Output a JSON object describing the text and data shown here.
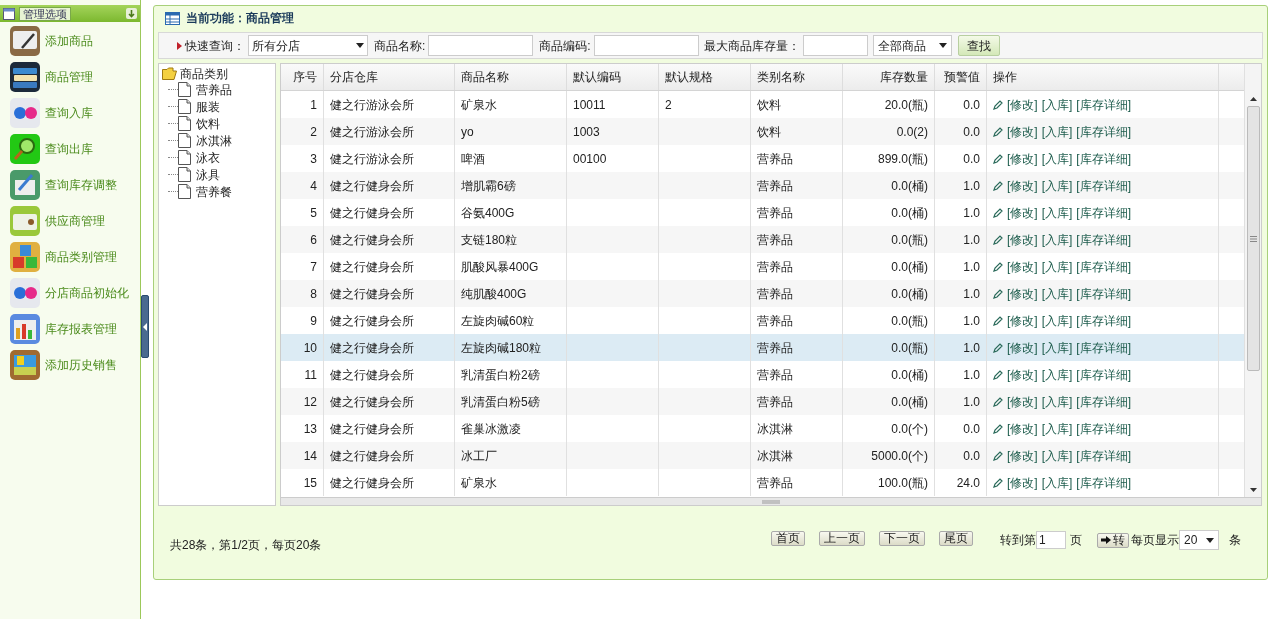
{
  "sidebar": {
    "header": "管理选项",
    "items": [
      {
        "label": "添加商品"
      },
      {
        "label": "商品管理"
      },
      {
        "label": "查询入库"
      },
      {
        "label": "查询出库"
      },
      {
        "label": "查询库存调整"
      },
      {
        "label": "供应商管理"
      },
      {
        "label": "商品类别管理"
      },
      {
        "label": "分店商品初始化"
      },
      {
        "label": "库存报表管理"
      },
      {
        "label": "添加历史销售"
      }
    ]
  },
  "panel": {
    "title": "当前功能：商品管理"
  },
  "search": {
    "quick_label": "快速查询：",
    "store_select": "所有分店",
    "name_label": "商品名称:",
    "code_label": "商品编码:",
    "max_stock_label": "最大商品库存量：",
    "type_select": "全部商品",
    "button": "查找"
  },
  "tree": {
    "label": "商品类别",
    "expanded": true,
    "children": [
      {
        "label": "营养品"
      },
      {
        "label": "服装"
      },
      {
        "label": "饮料"
      },
      {
        "label": "冰淇淋"
      },
      {
        "label": "泳衣"
      },
      {
        "label": "泳具"
      },
      {
        "label": "营养餐"
      }
    ]
  },
  "table": {
    "columns": [
      "序号",
      "分店仓库",
      "商品名称",
      "默认编码",
      "默认规格",
      "类别名称",
      "库存数量",
      "预警值",
      "操作"
    ],
    "rows": [
      {
        "cells": [
          "1",
          "健之行游泳会所",
          "矿泉水",
          "10011",
          "2",
          "饮料",
          "20.0(瓶)",
          "0.0"
        ],
        "actions": [
          "[修改]",
          "[入库]",
          "[库存详细]"
        ],
        "selected": false
      },
      {
        "cells": [
          "2",
          "健之行游泳会所",
          "yo",
          "1003",
          "",
          "饮料",
          "0.0(2)",
          "0.0"
        ],
        "actions": [
          "[修改]",
          "[入库]",
          "[库存详细]"
        ],
        "selected": false
      },
      {
        "cells": [
          "3",
          "健之行游泳会所",
          "啤酒",
          "00100",
          "",
          "营养品",
          "899.0(瓶)",
          "0.0"
        ],
        "actions": [
          "[修改]",
          "[入库]",
          "[库存详细]"
        ],
        "selected": false
      },
      {
        "cells": [
          "4",
          "健之行健身会所",
          "增肌霸6磅",
          "",
          "",
          "营养品",
          "0.0(桶)",
          "1.0"
        ],
        "actions": [
          "[修改]",
          "[入库]",
          "[库存详细]"
        ],
        "selected": false
      },
      {
        "cells": [
          "5",
          "健之行健身会所",
          "谷氨400G",
          "",
          "",
          "营养品",
          "0.0(桶)",
          "1.0"
        ],
        "actions": [
          "[修改]",
          "[入库]",
          "[库存详细]"
        ],
        "selected": false
      },
      {
        "cells": [
          "6",
          "健之行健身会所",
          "支链180粒",
          "",
          "",
          "营养品",
          "0.0(瓶)",
          "1.0"
        ],
        "actions": [
          "[修改]",
          "[入库]",
          "[库存详细]"
        ],
        "selected": false
      },
      {
        "cells": [
          "7",
          "健之行健身会所",
          "肌酸风暴400G",
          "",
          "",
          "营养品",
          "0.0(桶)",
          "1.0"
        ],
        "actions": [
          "[修改]",
          "[入库]",
          "[库存详细]"
        ],
        "selected": false
      },
      {
        "cells": [
          "8",
          "健之行健身会所",
          "纯肌酸400G",
          "",
          "",
          "营养品",
          "0.0(桶)",
          "1.0"
        ],
        "actions": [
          "[修改]",
          "[入库]",
          "[库存详细]"
        ],
        "selected": false
      },
      {
        "cells": [
          "9",
          "健之行健身会所",
          "左旋肉碱60粒",
          "",
          "",
          "营养品",
          "0.0(瓶)",
          "1.0"
        ],
        "actions": [
          "[修改]",
          "[入库]",
          "[库存详细]"
        ],
        "selected": false
      },
      {
        "cells": [
          "10",
          "健之行健身会所",
          "左旋肉碱180粒",
          "",
          "",
          "营养品",
          "0.0(瓶)",
          "1.0"
        ],
        "actions": [
          "[修改]",
          "[入库]",
          "[库存详细]"
        ],
        "selected": true
      },
      {
        "cells": [
          "11",
          "健之行健身会所",
          "乳清蛋白粉2磅",
          "",
          "",
          "营养品",
          "0.0(桶)",
          "1.0"
        ],
        "actions": [
          "[修改]",
          "[入库]",
          "[库存详细]"
        ],
        "selected": false
      },
      {
        "cells": [
          "12",
          "健之行健身会所",
          "乳清蛋白粉5磅",
          "",
          "",
          "营养品",
          "0.0(桶)",
          "1.0"
        ],
        "actions": [
          "[修改]",
          "[入库]",
          "[库存详细]"
        ],
        "selected": false
      },
      {
        "cells": [
          "13",
          "健之行健身会所",
          "雀巢冰激凌",
          "",
          "",
          "冰淇淋",
          "0.0(个)",
          "0.0"
        ],
        "actions": [
          "[修改]",
          "[入库]",
          "[库存详细]"
        ],
        "selected": false
      },
      {
        "cells": [
          "14",
          "健之行健身会所",
          "冰工厂",
          "",
          "",
          "冰淇淋",
          "5000.0(个)",
          "0.0"
        ],
        "actions": [
          "[修改]",
          "[入库]",
          "[库存详细]"
        ],
        "selected": false
      },
      {
        "cells": [
          "15",
          "健之行健身会所",
          "矿泉水",
          "",
          "",
          "营养品",
          "100.0(瓶)",
          "24.0"
        ],
        "actions": [
          "[修改]",
          "[入库]",
          "[库存详细]"
        ],
        "selected": false
      }
    ]
  },
  "pagination": {
    "summary": "共28条，第1/2页，每页20条",
    "buttons": [
      "首页",
      "上一页",
      "下一页",
      "尾页"
    ],
    "goto_label": "转到第",
    "page_value": "1",
    "page_unit": "页",
    "go_button": "转",
    "per_page_label": "每页显示",
    "per_page": "20",
    "per_page_unit": "条"
  }
}
